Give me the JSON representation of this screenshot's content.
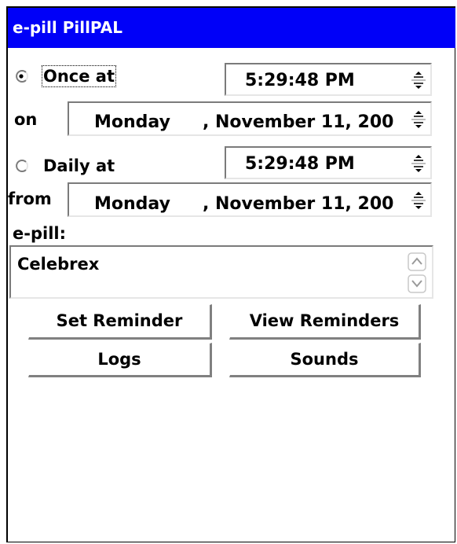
{
  "window": {
    "title": "e-pill PillPAL"
  },
  "once": {
    "radio_label": "Once at",
    "selected": true,
    "time": "5:29:48 PM",
    "date_label": "on",
    "weekday": "Monday",
    "date": ", November 11, 200"
  },
  "daily": {
    "radio_label": "Daily at",
    "selected": false,
    "time": "5:29:48 PM",
    "date_label": "from",
    "weekday": "Monday",
    "date": ", November 11, 200"
  },
  "pill": {
    "label": "e-pill:",
    "value": "Celebrex"
  },
  "buttons": {
    "set_reminder": "Set Reminder",
    "view_reminders": "View Reminders",
    "logs": "Logs",
    "sounds": "Sounds"
  },
  "icons": {
    "spin_up": "spin-up-arrow-icon",
    "spin_down": "spin-down-arrow-icon",
    "scroll_up": "scroll-up-icon",
    "scroll_down": "scroll-down-icon"
  }
}
